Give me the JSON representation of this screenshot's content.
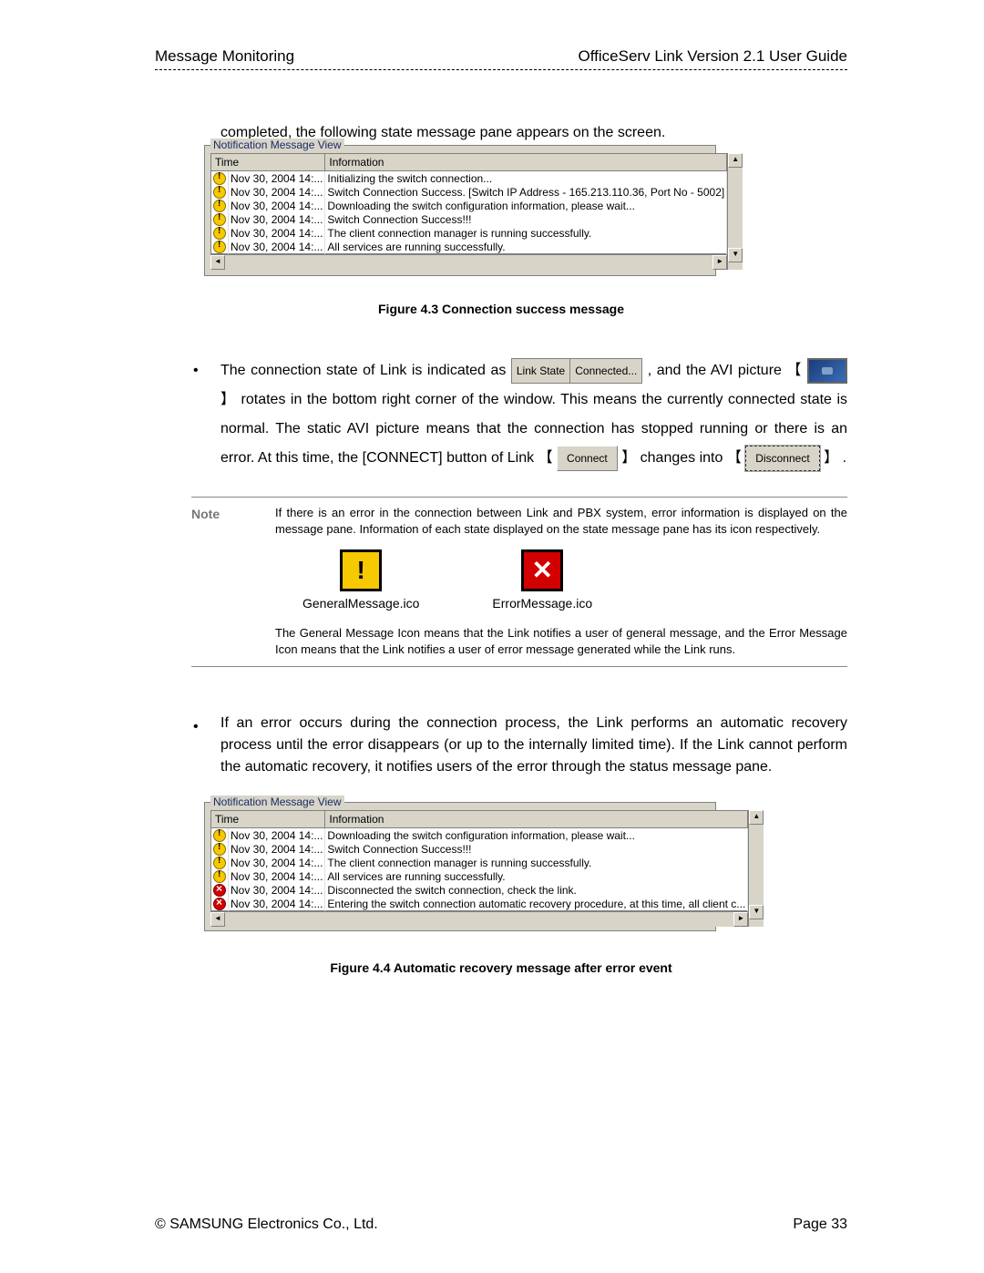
{
  "header": {
    "left": "Message Monitoring",
    "right": "OfficeServ Link Version 2.1 User Guide"
  },
  "intro_text": "completed, the following state message pane appears on the screen.",
  "nmv1": {
    "title": "Notification Message View",
    "col_time": "Time",
    "col_info": "Information",
    "rows": [
      {
        "icon": "general",
        "time": "Nov 30, 2004 14:...",
        "info": "Initializing the switch connection..."
      },
      {
        "icon": "general",
        "time": "Nov 30, 2004 14:...",
        "info": "Switch Connection Success. [Switch IP Address - 165.213.110.36, Port No - 5002]"
      },
      {
        "icon": "general",
        "time": "Nov 30, 2004 14:...",
        "info": "Downloading the switch configuration information, please wait..."
      },
      {
        "icon": "general",
        "time": "Nov 30, 2004 14:...",
        "info": "Switch Connection Success!!!"
      },
      {
        "icon": "general",
        "time": "Nov 30, 2004 14:...",
        "info": "The client connection manager is running successfully."
      },
      {
        "icon": "general",
        "time": "Nov 30, 2004 14:...",
        "info": "All services are running successfully."
      }
    ]
  },
  "figure1_caption": "Figure 4.3 Connection success message",
  "para1": {
    "t1": "The connection state of Link is indicated as ",
    "link_state_label": "Link State",
    "link_state_value": "Connected...",
    "t2": ", and the AVI picture 【",
    "t3": "】 rotates in the bottom right corner of the window. This means the currently connected state is normal. The static AVI picture means that the connection has stopped running or there is an error. At this time, the [CONNECT] button of Link 【",
    "connect_btn": "Connect",
    "t4": "】 changes into 【",
    "disconnect_btn": "Disconnect",
    "t5": "】 ."
  },
  "note": {
    "label": "Note",
    "p1": "If there is an error in the connection between Link and PBX system, error information is displayed on the message pane. Information of each state displayed on the state message pane has its icon respectively.",
    "general_ico": "GeneralMessage.ico",
    "error_ico": "ErrorMessage.ico",
    "p2": "The General Message Icon means that the Link notifies a user of general message, and the Error Message Icon means that the Link notifies a user of error message generated while the Link runs."
  },
  "para2": "If an error occurs during the connection process, the Link performs an automatic recovery process until the error disappears (or up to the internally limited time). If the Link cannot perform the automatic recovery, it notifies users of the error through the status message pane.",
  "nmv2": {
    "title": "Notification Message View",
    "col_time": "Time",
    "col_info": "Information",
    "rows": [
      {
        "icon": "general",
        "time": "Nov 30, 2004 14:...",
        "info": "Downloading the switch configuration information, please wait..."
      },
      {
        "icon": "general",
        "time": "Nov 30, 2004 14:...",
        "info": "Switch Connection Success!!!"
      },
      {
        "icon": "general",
        "time": "Nov 30, 2004 14:...",
        "info": "The client connection manager is running successfully."
      },
      {
        "icon": "general",
        "time": "Nov 30, 2004 14:...",
        "info": "All services are running successfully."
      },
      {
        "icon": "error",
        "time": "Nov 30, 2004 14:...",
        "info": "Disconnected the switch connection, check the link."
      },
      {
        "icon": "error",
        "time": "Nov 30, 2004 14:...",
        "info": "Entering the switch connection automatic recovery procedure, at this time, all client c..."
      }
    ]
  },
  "figure2_caption": "Figure 4.4   Automatic recovery message after error event",
  "footer": {
    "left": "© SAMSUNG Electronics Co., Ltd.",
    "right": "Page 33"
  }
}
